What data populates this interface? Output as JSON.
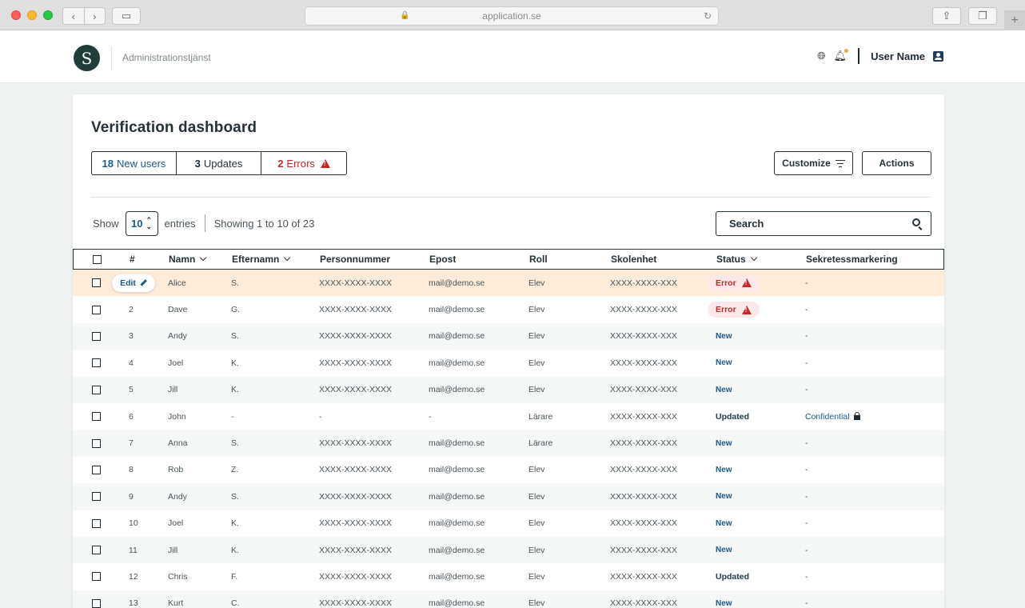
{
  "browser": {
    "url": "application.se"
  },
  "header": {
    "logo_letter": "S",
    "app_name": "Administrationstjänst",
    "user_name": "User Name"
  },
  "page": {
    "title": "Verification dashboard"
  },
  "summary": {
    "new_count": "18",
    "new_label": "New users",
    "updates_count": "3",
    "updates_label": "Updates",
    "errors_count": "2",
    "errors_label": "Errors"
  },
  "toolbar": {
    "customize_label": "Customize",
    "actions_label": "Actions"
  },
  "list_controls": {
    "show_label": "Show",
    "entries_value": "10",
    "entries_label": "entries",
    "showing_text": "Showing 1 to 10 of 23",
    "search_placeholder": "Search"
  },
  "table": {
    "columns": {
      "num": "#",
      "name": "Namn",
      "last": "Efternamn",
      "pnr": "Personnummer",
      "mail": "Epost",
      "roll": "Roll",
      "skol": "Skolenhet",
      "stat": "Status",
      "sekr": "Sekretessmarkering"
    },
    "edit_label": "Edit",
    "rows": [
      {
        "num": "",
        "name": "Alice",
        "last": "S.",
        "pnr": "XXXX-XXXX-XXXX",
        "mail": "mail@demo.se",
        "roll": "Elev",
        "skol": "XXXX-XXXX-XXX",
        "stat": "Error",
        "sekr": "-"
      },
      {
        "num": "2",
        "name": "Dave",
        "last": "G.",
        "pnr": "XXXX-XXXX-XXXX",
        "mail": "mail@demo.se",
        "roll": "Elev",
        "skol": "XXXX-XXXX-XXX",
        "stat": "Error",
        "sekr": "-"
      },
      {
        "num": "3",
        "name": "Andy",
        "last": "S.",
        "pnr": "XXXX-XXXX-XXXX",
        "mail": "mail@demo.se",
        "roll": "Elev",
        "skol": "XXXX-XXXX-XXX",
        "stat": "New",
        "sekr": "-"
      },
      {
        "num": "4",
        "name": "Joel",
        "last": "K.",
        "pnr": "XXXX-XXXX-XXXX",
        "mail": "mail@demo.se",
        "roll": "Elev",
        "skol": "XXXX-XXXX-XXX",
        "stat": "New",
        "sekr": "-"
      },
      {
        "num": "5",
        "name": "Jill",
        "last": "K.",
        "pnr": "XXXX-XXXX-XXXX",
        "mail": "mail@demo.se",
        "roll": "Elev",
        "skol": "XXXX-XXXX-XXX",
        "stat": "New",
        "sekr": "-"
      },
      {
        "num": "6",
        "name": "John",
        "last": "-",
        "pnr": "-",
        "mail": "-",
        "roll": "Lärare",
        "skol": "XXXX-XXXX-XXX",
        "stat": "Updated",
        "sekr": "Confidential"
      },
      {
        "num": "7",
        "name": "Anna",
        "last": "S.",
        "pnr": "XXXX-XXXX-XXXX",
        "mail": "mail@demo.se",
        "roll": "Lärare",
        "skol": "XXXX-XXXX-XXX",
        "stat": "New",
        "sekr": "-"
      },
      {
        "num": "8",
        "name": "Rob",
        "last": "Z.",
        "pnr": "XXXX-XXXX-XXXX",
        "mail": "mail@demo.se",
        "roll": "Elev",
        "skol": "XXXX-XXXX-XXX",
        "stat": "New",
        "sekr": "-"
      },
      {
        "num": "9",
        "name": "Andy",
        "last": "S.",
        "pnr": "XXXX-XXXX-XXXX",
        "mail": "mail@demo.se",
        "roll": "Elev",
        "skol": "XXXX-XXXX-XXX",
        "stat": "New",
        "sekr": "-"
      },
      {
        "num": "10",
        "name": "Joel",
        "last": "K.",
        "pnr": "XXXX-XXXX-XXXX",
        "mail": "mail@demo.se",
        "roll": "Elev",
        "skol": "XXXX-XXXX-XXX",
        "stat": "New",
        "sekr": "-"
      },
      {
        "num": "11",
        "name": "Jill",
        "last": "K.",
        "pnr": "XXXX-XXXX-XXXX",
        "mail": "mail@demo.se",
        "roll": "Elev",
        "skol": "XXXX-XXXX-XXX",
        "stat": "New",
        "sekr": "-"
      },
      {
        "num": "12",
        "name": "Chris",
        "last": "F.",
        "pnr": "XXXX-XXXX-XXXX",
        "mail": "mail@demo.se",
        "roll": "Elev",
        "skol": "XXXX-XXXX-XXX",
        "stat": "Updated",
        "sekr": "-"
      },
      {
        "num": "13",
        "name": "Kurt",
        "last": "C.",
        "pnr": "XXXX-XXXX-XXXX",
        "mail": "mail@demo.se",
        "roll": "Elev",
        "skol": "XXXX-XXXX-XXX",
        "stat": "New",
        "sekr": "-"
      }
    ]
  },
  "colors": {
    "accent": "#1d5a8a",
    "error": "#c62828",
    "highlight_row": "#fdecd9",
    "dark": "#243238"
  }
}
